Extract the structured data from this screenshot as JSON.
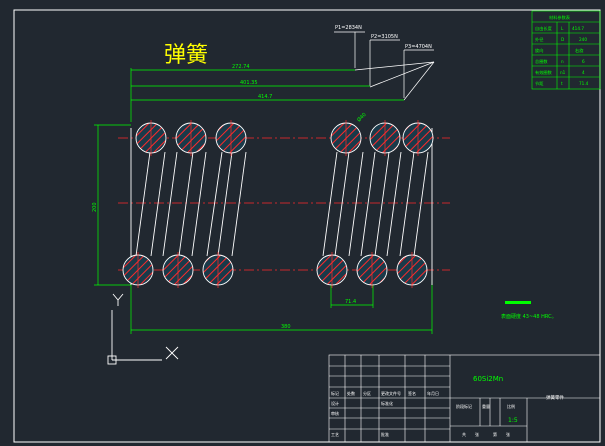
{
  "drawing": {
    "title_cn": "弹簧",
    "forces": {
      "p1": "P1=2834N",
      "p2": "P2=3105N",
      "p3": "P3=4704N"
    },
    "dims": {
      "d1": "272.74",
      "d2": "401.35",
      "d3": "414.7",
      "length": "380",
      "pitch": "71.4",
      "height": "200",
      "wire": "Ø40"
    },
    "note": "表面硬度 43~48 HRC。",
    "material": "60Si2Mn",
    "scale": "1:5"
  },
  "param_table": {
    "title": "材料参数表",
    "rows": [
      {
        "a": "自由长度",
        "b": "L",
        "c": "414.7"
      },
      {
        "a": "外径",
        "b": "D",
        "c": "240"
      },
      {
        "a": "旋向",
        "b": "",
        "c": "右旋"
      },
      {
        "a": "总圈数",
        "b": "n",
        "c": "6"
      },
      {
        "a": "有效圈数",
        "b": "n1",
        "c": "4"
      },
      {
        "a": "节距",
        "b": "t",
        "c": "71.4"
      }
    ]
  },
  "title_block": {
    "r1": [
      "标记",
      "处数",
      "分区",
      "更改文件号",
      "签名",
      "年月日"
    ],
    "r2": [
      "设计",
      "标准化"
    ],
    "r3": [
      "审核"
    ],
    "r4": [
      "工艺",
      "批准"
    ],
    "right_labels": [
      "阶段标记",
      "重量",
      "比例"
    ],
    "sheet": [
      "共",
      "张",
      "第",
      "张"
    ],
    "company": "弹簧零件"
  },
  "axes": {
    "x": "X",
    "y": "Y"
  },
  "colors": {
    "bg": "#212830",
    "line": "#ffffff",
    "dim": "#00ff00",
    "center": "#ff0000",
    "hatch": "#00c8ff",
    "title": "#ffff00"
  }
}
